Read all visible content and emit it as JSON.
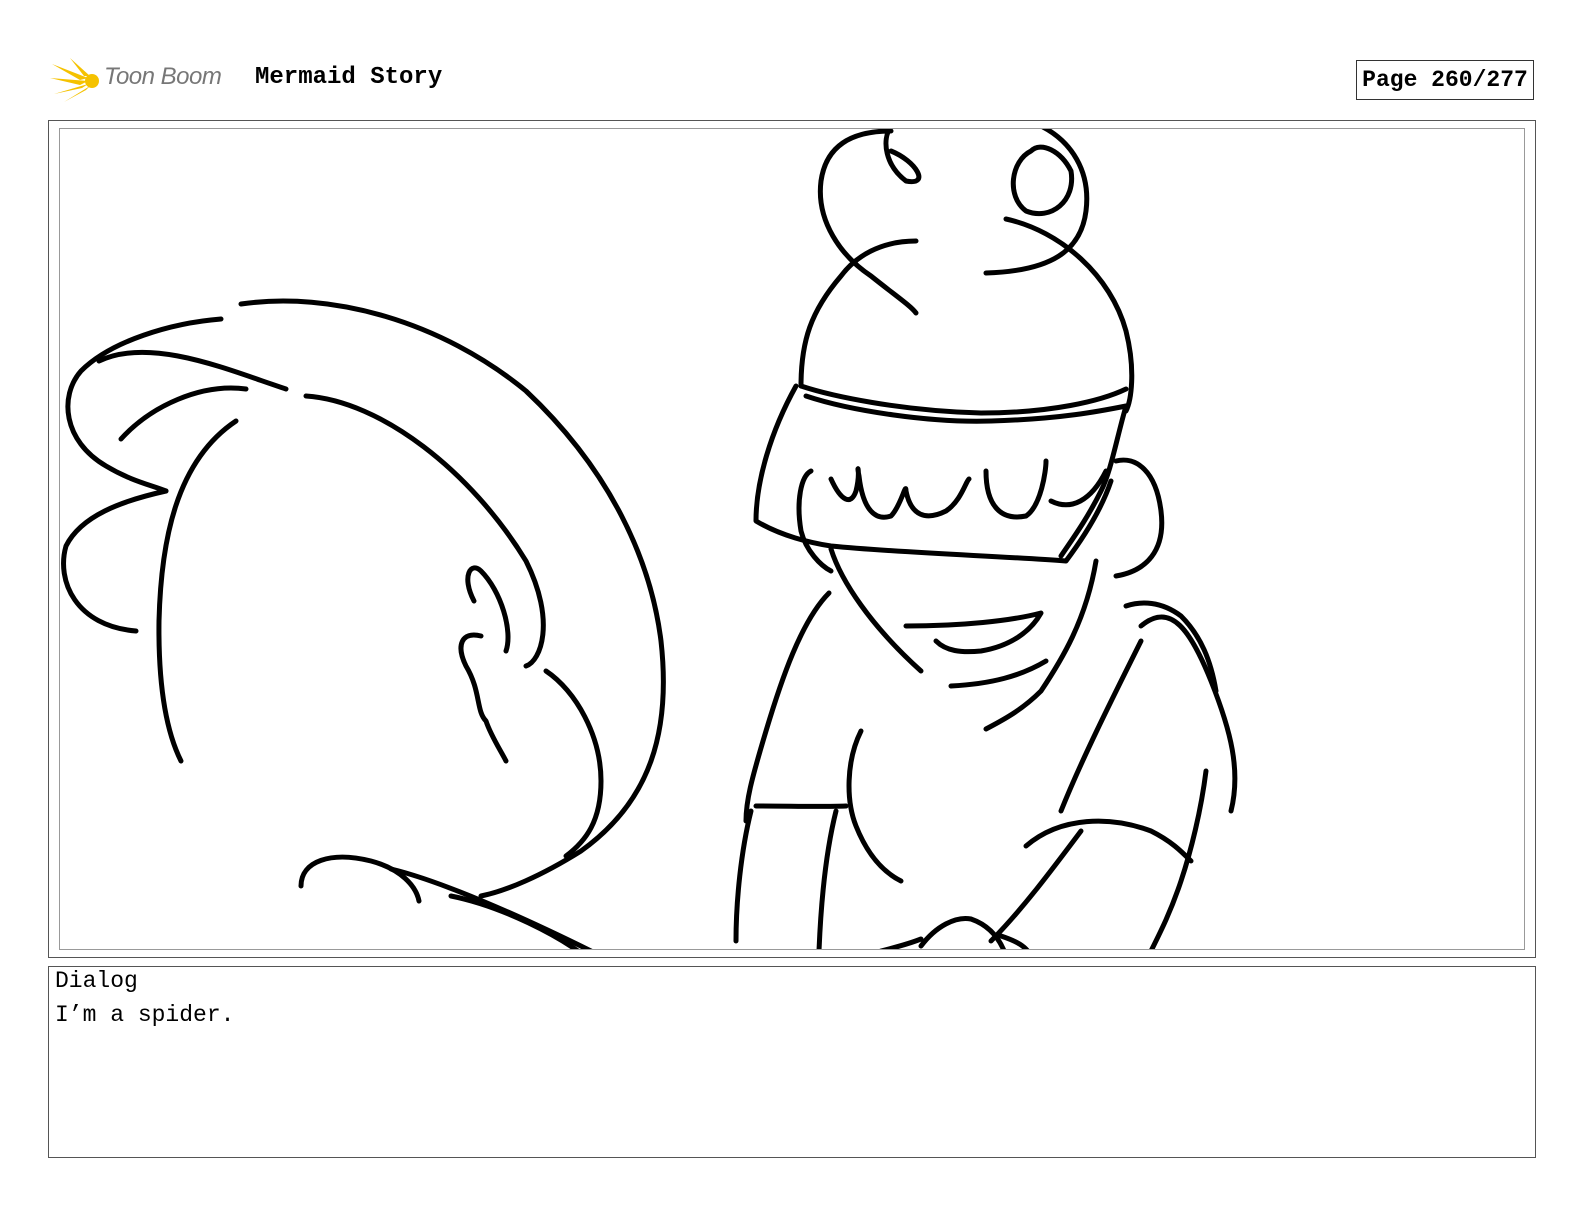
{
  "header": {
    "logo_text": "Toon Boom",
    "project_title": "Mermaid Story",
    "page_indicator": "Page 260/277"
  },
  "panel": {
    "sketch_icon": "storyboard-sketch-illustration"
  },
  "dialog": {
    "label": "Dialog",
    "text": "I’m a spider."
  },
  "colors": {
    "logo_yellow": "#F5C200",
    "logo_text_gray": "#777777",
    "frame_border": "#555555"
  }
}
